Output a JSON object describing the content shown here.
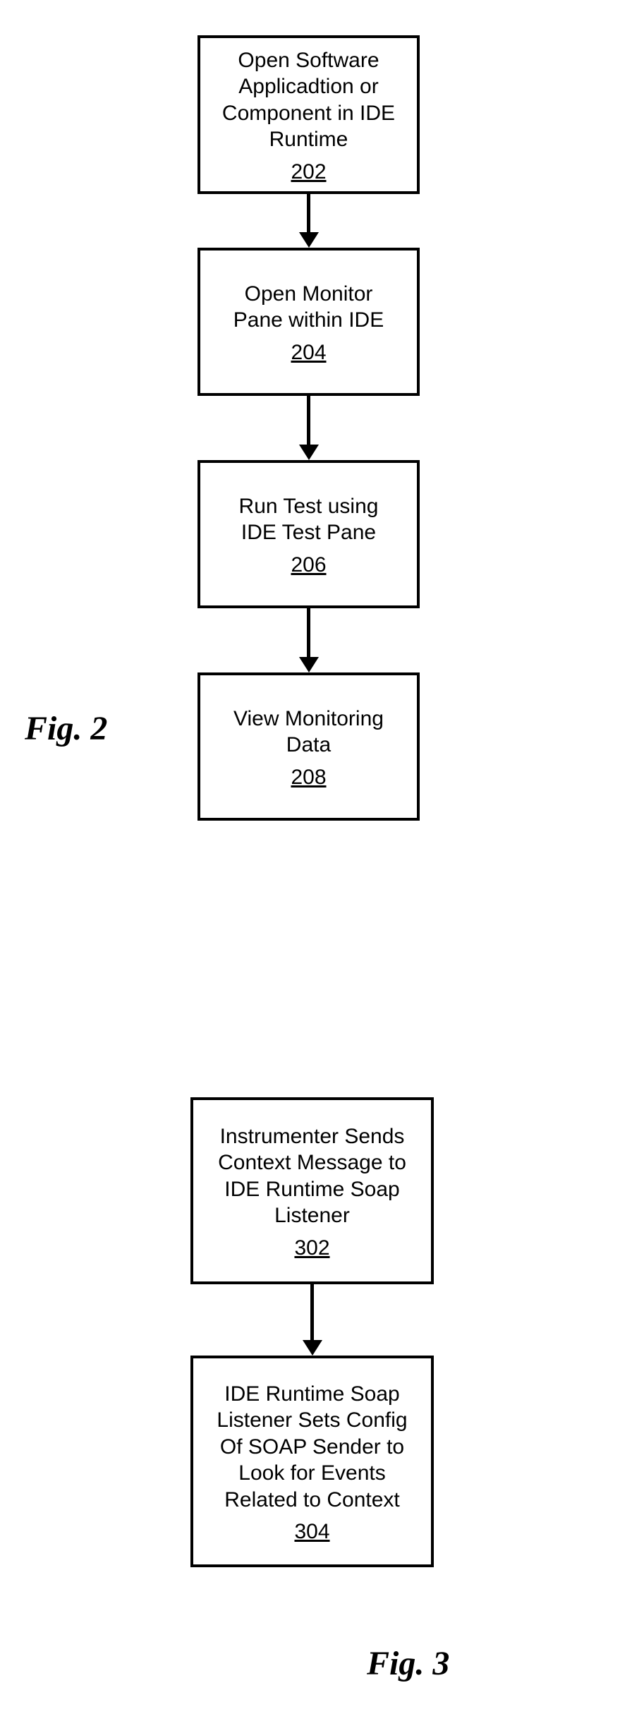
{
  "figures": {
    "fig2": {
      "label": "Fig. 2",
      "nodes": [
        {
          "text": "Open Software\nApplicadtion or\nComponent in IDE\nRuntime",
          "ref": "202"
        },
        {
          "text": "Open Monitor\nPane within IDE",
          "ref": "204"
        },
        {
          "text": "Run Test using\nIDE Test Pane",
          "ref": "206"
        },
        {
          "text": "View Monitoring\nData",
          "ref": "208"
        }
      ]
    },
    "fig3": {
      "label": "Fig. 3",
      "nodes": [
        {
          "text": "Instrumenter Sends\nContext Message to\nIDE Runtime Soap\nListener",
          "ref": "302"
        },
        {
          "text": "IDE Runtime Soap\nListener Sets Config\nOf SOAP Sender to\nLook for Events\nRelated to Context",
          "ref": "304"
        }
      ]
    }
  }
}
